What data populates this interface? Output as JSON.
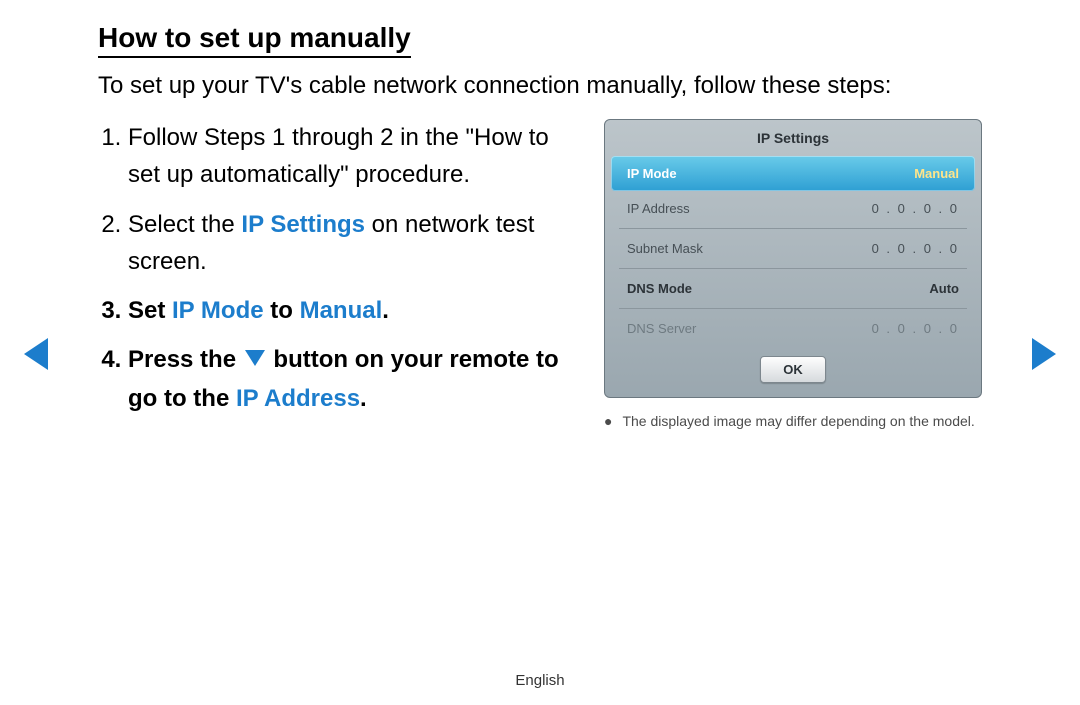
{
  "title": "How to set up manually",
  "intro": "To set up your TV's cable network connection manually, follow these steps:",
  "steps": {
    "s1": "Follow Steps 1 through 2 in the \"How to set up automatically\" procedure.",
    "s2a": "Select the ",
    "s2b": "IP Settings",
    "s2c": " on network test screen.",
    "s3a": "Set ",
    "s3b": "IP Mode",
    "s3c": " to ",
    "s3d": "Manual",
    "s3e": ".",
    "s4a": "Press the ",
    "s4b": " button on your remote to go to the ",
    "s4c": "IP Address",
    "s4d": "."
  },
  "panel": {
    "title": "IP Settings",
    "rows": {
      "ip_mode": {
        "label": "IP Mode",
        "value": "Manual"
      },
      "ip_address": {
        "label": "IP Address",
        "value": "0 . 0 . 0 . 0"
      },
      "subnet_mask": {
        "label": "Subnet Mask",
        "value": "0 . 0 . 0 . 0"
      },
      "dns_mode": {
        "label": "DNS Mode",
        "value": "Auto"
      },
      "dns_server": {
        "label": "DNS Server",
        "value": "0 . 0 . 0 . 0"
      }
    },
    "ok": "OK"
  },
  "note": "The displayed image may differ depending on the model.",
  "footer": "English"
}
